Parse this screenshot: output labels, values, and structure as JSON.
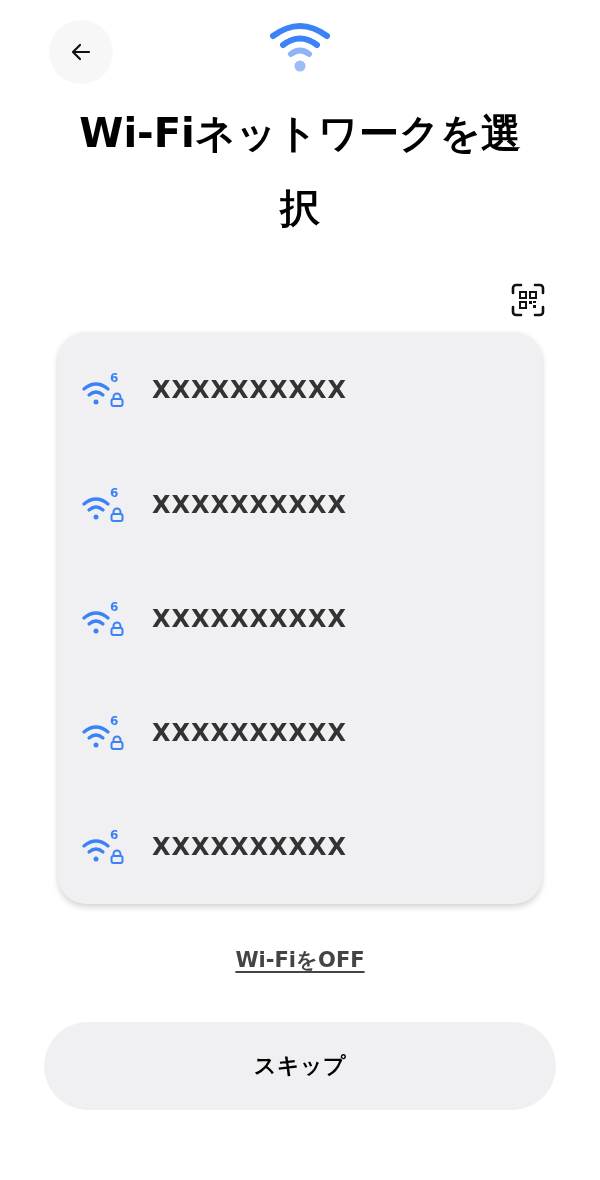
{
  "title": "Wi-Fiネットワークを選択",
  "networks": [
    {
      "name": "XXXXXXXXXX",
      "badge": "6",
      "secured": true
    },
    {
      "name": "XXXXXXXXXX",
      "badge": "6",
      "secured": true
    },
    {
      "name": "XXXXXXXXXX",
      "badge": "6",
      "secured": true
    },
    {
      "name": "XXXXXXXXXX",
      "badge": "6",
      "secured": true
    },
    {
      "name": "XXXXXXXXXX",
      "badge": "6",
      "secured": true
    }
  ],
  "wifi_off_link": "Wi-FiをOFF",
  "skip_button": "スキップ"
}
